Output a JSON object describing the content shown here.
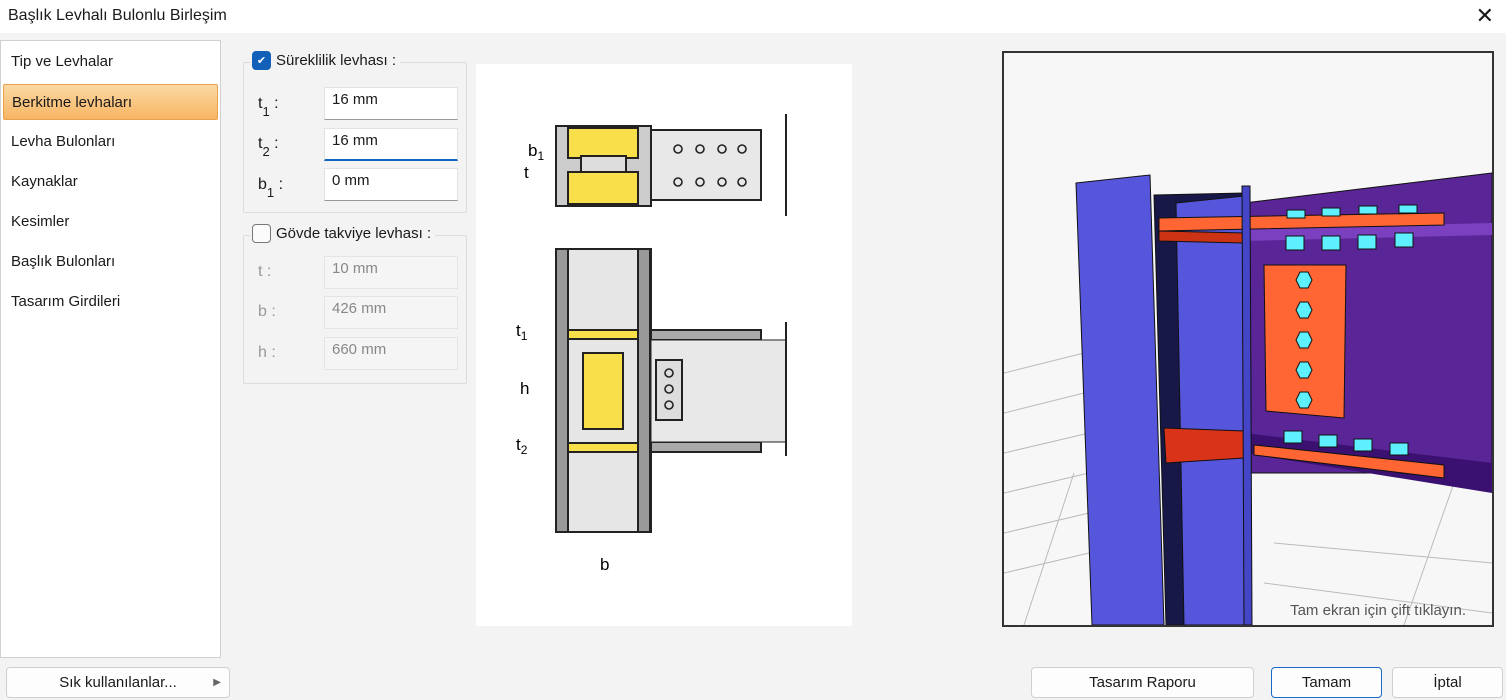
{
  "window": {
    "title": "Başlık Levhalı Bulonlu Birleşim",
    "close_icon": "close-icon"
  },
  "sidebar": {
    "items": [
      {
        "label": "Tip ve Levhalar"
      },
      {
        "label": "Berkitme levhaları",
        "selected": true
      },
      {
        "label": "Levha Bulonları"
      },
      {
        "label": "Kaynaklar"
      },
      {
        "label": "Kesimler"
      },
      {
        "label": "Başlık Bulonları"
      },
      {
        "label": "Tasarım Girdileri"
      }
    ]
  },
  "continuity": {
    "label": "Süreklilik levhası :",
    "checked": true,
    "fields": [
      {
        "sym": "t",
        "sub": "1",
        "value": "16 mm"
      },
      {
        "sym": "t",
        "sub": "2",
        "value": "16 mm"
      },
      {
        "sym": "b",
        "sub": "1",
        "value": "0 mm"
      }
    ]
  },
  "web": {
    "label": "Gövde takviye levhası :",
    "checked": false,
    "fields": [
      {
        "sym": "t",
        "value": "10 mm"
      },
      {
        "sym": "b",
        "value": "426 mm"
      },
      {
        "sym": "h",
        "value": "660 mm"
      }
    ]
  },
  "diagram": {
    "labels": {
      "b1": "b",
      "b1sub": "1",
      "t": "t",
      "t1": "t",
      "t1sub": "1",
      "h": "h",
      "t2": "t",
      "t2sub": "2",
      "b": "b"
    }
  },
  "viewer": {
    "hint": "Tam ekran için çift tıklayın."
  },
  "footer": {
    "favorites": "Sık kullanılanlar...",
    "report": "Tasarım Raporu",
    "ok": "Tamam",
    "cancel": "İptal"
  },
  "colors": {
    "accent": "#1260b8",
    "selected": "#f7b563",
    "column": "#5656dc",
    "beam": "#5a2596",
    "plate": "#ff6633",
    "bolt": "#5ef0ff"
  }
}
